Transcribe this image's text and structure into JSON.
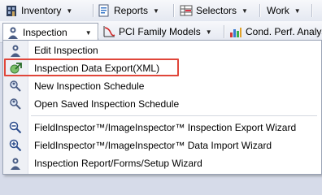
{
  "toolbar": {
    "row1": [
      {
        "label": "Inventory",
        "icon": "building-icon"
      },
      {
        "label": "Reports",
        "icon": "report-icon"
      },
      {
        "label": "Selectors",
        "icon": "selector-grid-icon"
      },
      {
        "label": "Work",
        "icon": ""
      }
    ],
    "row2": [
      {
        "label": "Inspection",
        "icon": "inspector-icon"
      },
      {
        "label": "PCI Family Models",
        "icon": "curve-chart-icon"
      },
      {
        "label": "Cond. Perf. Analys",
        "icon": "bar-chart-icon"
      }
    ]
  },
  "inspection_menu": {
    "items": [
      {
        "label": "Edit Inspection",
        "icon": "inspector-person-icon"
      },
      {
        "label": "Inspection Data Export(XML)",
        "icon": "export-arrow-icon"
      },
      {
        "label": "New Inspection Schedule",
        "icon": "magnifier-person-icon"
      },
      {
        "label": "Open Saved Inspection Schedule",
        "icon": "magnifier-person-icon"
      },
      {
        "label": "FieldInspector™/ImageInspector™ Inspection Export Wizard",
        "icon": "magnifier-minus-icon"
      },
      {
        "label": "FieldInspector™/ImageInspector™ Data Import Wizard",
        "icon": "magnifier-plus-icon"
      },
      {
        "label": "Inspection Report/Forms/Setup Wizard",
        "icon": "inspector-person-icon"
      }
    ],
    "highlighted_item": "Inspection Data Export(XML)"
  },
  "colors": {
    "highlight_border": "#e0463a",
    "menu_background": "#ffffff",
    "toolbar_background": "#e9ecf3"
  }
}
